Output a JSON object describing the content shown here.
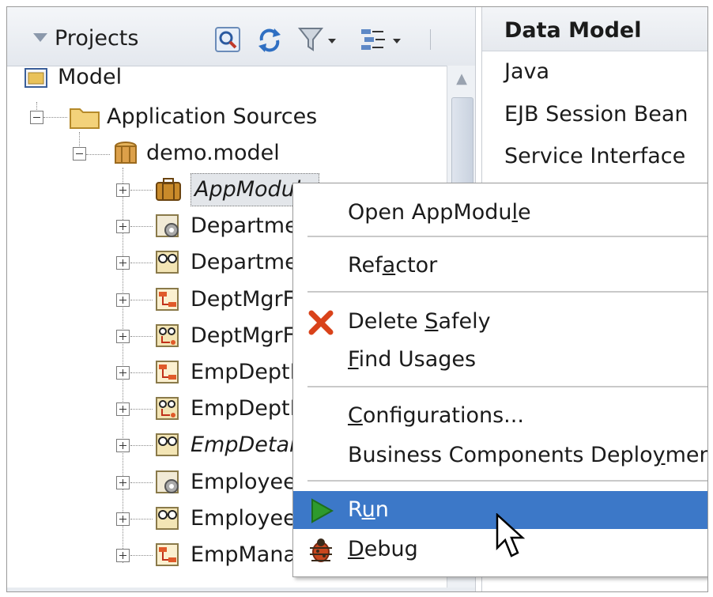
{
  "projects_panel": {
    "title": "Projects",
    "toolbar_icons": [
      "search-icon",
      "sync-icon",
      "filter-icon",
      "view-options-icon"
    ]
  },
  "tree": {
    "root": {
      "label": "Model",
      "icon": "project-icon"
    },
    "app_sources": {
      "label": "Application Sources",
      "icon": "folder-icon"
    },
    "package": {
      "label": "demo.model",
      "icon": "package-icon"
    },
    "items": [
      {
        "label": "AppModule",
        "icon": "app-module-icon",
        "italic": true,
        "selected": true
      },
      {
        "label": "Departme",
        "icon": "entity-object-icon",
        "italic": false
      },
      {
        "label": "Departme",
        "icon": "view-object-icon",
        "italic": false
      },
      {
        "label": "DeptMgrF",
        "icon": "association-icon",
        "italic": false
      },
      {
        "label": "DeptMgrF",
        "icon": "view-link-icon",
        "italic": false
      },
      {
        "label": "EmpDeptF",
        "icon": "association-icon",
        "italic": false
      },
      {
        "label": "EmpDeptF",
        "icon": "view-link-icon",
        "italic": false
      },
      {
        "label": "EmpDetai",
        "icon": "view-object-icon",
        "italic": true
      },
      {
        "label": "Employee",
        "icon": "entity-object-icon",
        "italic": false
      },
      {
        "label": "Employee",
        "icon": "view-object-icon",
        "italic": false
      },
      {
        "label": "EmpMana",
        "icon": "association-icon",
        "italic": false
      }
    ]
  },
  "data_model_panel": {
    "title": "Data Model",
    "rows": [
      "Java",
      "EJB Session Bean",
      "Service Interface"
    ]
  },
  "context_menu": {
    "items": [
      {
        "label": "Open AppModule",
        "mnemonic": "l",
        "icon": null
      },
      {
        "label": "Refactor",
        "mnemonic": "a",
        "icon": null
      },
      {
        "label": "Delete Safely",
        "mnemonic": "S",
        "icon": "delete-icon"
      },
      {
        "label": "Find Usages",
        "mnemonic": "F",
        "icon": null
      },
      {
        "label": "Configurations...",
        "mnemonic": "C",
        "icon": null
      },
      {
        "label": "Business Components Deployment",
        "mnemonic": "y",
        "icon": null
      },
      {
        "label": "Run",
        "mnemonic": "u",
        "icon": "run-icon",
        "selected": true
      },
      {
        "label": "Debug",
        "mnemonic": "D",
        "icon": "debug-icon"
      }
    ]
  },
  "colors": {
    "selection": "#3c78c8",
    "header_bg": "#e8ecf1",
    "delete_icon": "#d9421a",
    "run_icon": "#2e9a2e",
    "debug_icon": "#c8461e"
  }
}
